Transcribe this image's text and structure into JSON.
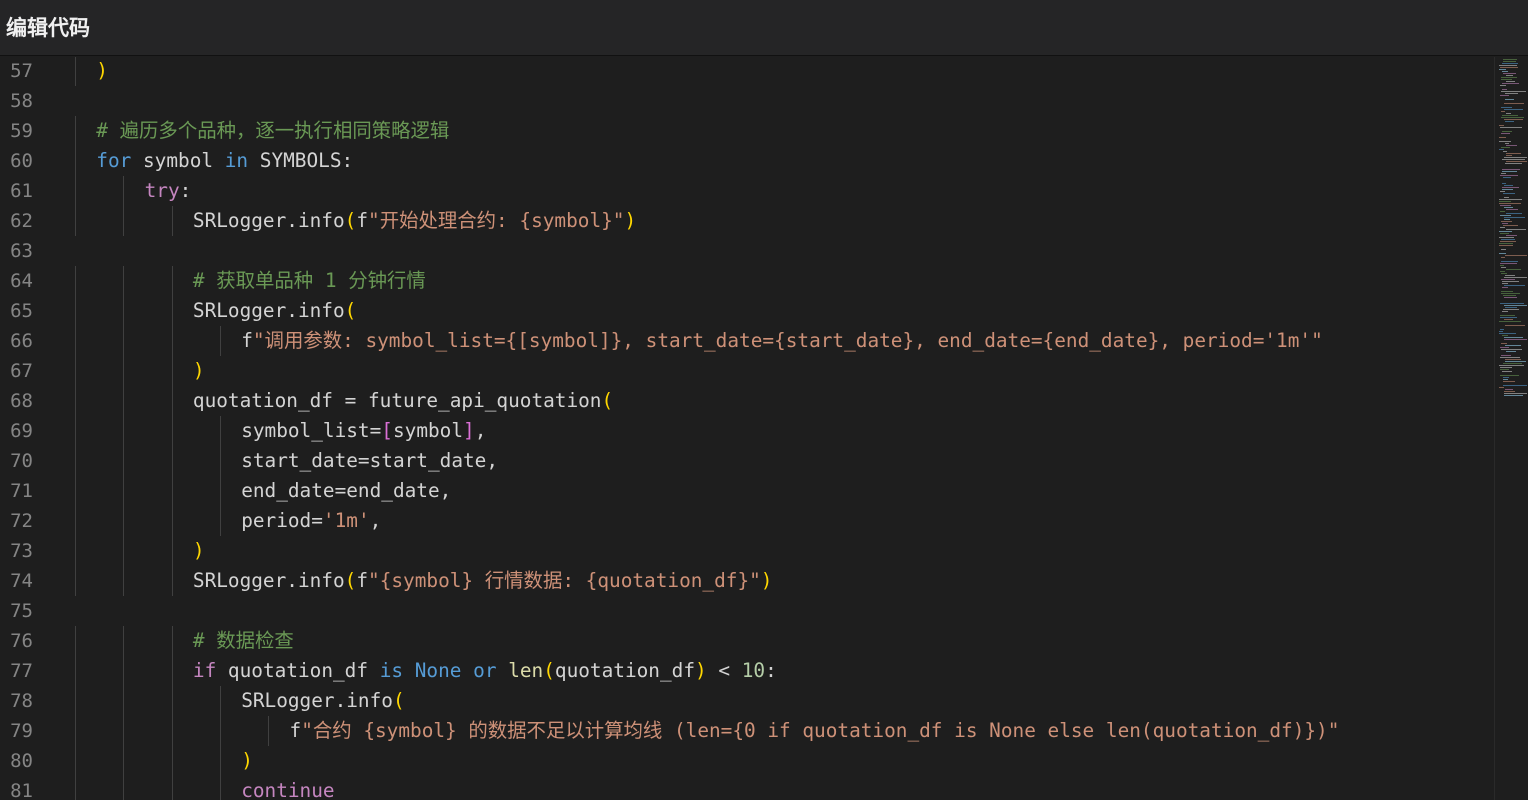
{
  "window": {
    "title": "编辑代码"
  },
  "editor": {
    "lines": [
      {
        "n": "57",
        "indent": 1,
        "tokens": [
          [
            "p1",
            ")"
          ]
        ]
      },
      {
        "n": "58",
        "indent": 0,
        "tokens": []
      },
      {
        "n": "59",
        "indent": 1,
        "tokens": [
          [
            "com",
            "# 遍历多个品种，逐一执行相同策略逻辑"
          ]
        ]
      },
      {
        "n": "60",
        "indent": 1,
        "tokens": [
          [
            "kw",
            "for"
          ],
          [
            "id",
            " symbol "
          ],
          [
            "kw",
            "in"
          ],
          [
            "id",
            " SYMBOLS:"
          ]
        ]
      },
      {
        "n": "61",
        "indent": 2,
        "tokens": [
          [
            "ctl",
            "try"
          ],
          [
            "id",
            ":"
          ]
        ]
      },
      {
        "n": "62",
        "indent": 3,
        "tokens": [
          [
            "id",
            "SRLogger.info"
          ],
          [
            "p1",
            "("
          ],
          [
            "id",
            "f"
          ],
          [
            "str",
            "\"开始处理合约: {symbol}\""
          ],
          [
            "p1",
            ")"
          ]
        ]
      },
      {
        "n": "63",
        "indent": 0,
        "tokens": []
      },
      {
        "n": "64",
        "indent": 3,
        "tokens": [
          [
            "com",
            "# 获取单品种 1 分钟行情"
          ]
        ]
      },
      {
        "n": "65",
        "indent": 3,
        "tokens": [
          [
            "id",
            "SRLogger.info"
          ],
          [
            "p1",
            "("
          ]
        ]
      },
      {
        "n": "66",
        "indent": 4,
        "tokens": [
          [
            "id",
            "f"
          ],
          [
            "str",
            "\"调用参数: symbol_list={[symbol]}, start_date={start_date}, end_date={end_date}, period='1m'\""
          ]
        ]
      },
      {
        "n": "67",
        "indent": 3,
        "tokens": [
          [
            "p1",
            ")"
          ]
        ]
      },
      {
        "n": "68",
        "indent": 3,
        "tokens": [
          [
            "id",
            "quotation_df = future_api_quotation"
          ],
          [
            "p1",
            "("
          ]
        ]
      },
      {
        "n": "69",
        "indent": 4,
        "tokens": [
          [
            "id",
            "symbol_list="
          ],
          [
            "p2",
            "["
          ],
          [
            "id",
            "symbol"
          ],
          [
            "p2",
            "]"
          ],
          [
            "id",
            ","
          ]
        ]
      },
      {
        "n": "70",
        "indent": 4,
        "tokens": [
          [
            "id",
            "start_date=start_date,"
          ]
        ]
      },
      {
        "n": "71",
        "indent": 4,
        "tokens": [
          [
            "id",
            "end_date=end_date,"
          ]
        ]
      },
      {
        "n": "72",
        "indent": 4,
        "tokens": [
          [
            "id",
            "period="
          ],
          [
            "str",
            "'1m'"
          ],
          [
            "id",
            ","
          ]
        ]
      },
      {
        "n": "73",
        "indent": 3,
        "tokens": [
          [
            "p1",
            ")"
          ]
        ]
      },
      {
        "n": "74",
        "indent": 3,
        "tokens": [
          [
            "id",
            "SRLogger.info"
          ],
          [
            "p1",
            "("
          ],
          [
            "id",
            "f"
          ],
          [
            "str",
            "\"{symbol} 行情数据: {quotation_df}\""
          ],
          [
            "p1",
            ")"
          ]
        ]
      },
      {
        "n": "75",
        "indent": 0,
        "tokens": []
      },
      {
        "n": "76",
        "indent": 3,
        "tokens": [
          [
            "com",
            "# 数据检查"
          ]
        ]
      },
      {
        "n": "77",
        "indent": 3,
        "tokens": [
          [
            "ctl",
            "if"
          ],
          [
            "id",
            " quotation_df "
          ],
          [
            "kw",
            "is"
          ],
          [
            "id",
            " "
          ],
          [
            "kw",
            "None"
          ],
          [
            "id",
            " "
          ],
          [
            "kw",
            "or"
          ],
          [
            "id",
            " "
          ],
          [
            "fn",
            "len"
          ],
          [
            "p1",
            "("
          ],
          [
            "id",
            "quotation_df"
          ],
          [
            "p1",
            ")"
          ],
          [
            "id",
            " < "
          ],
          [
            "num",
            "10"
          ],
          [
            "id",
            ":"
          ]
        ]
      },
      {
        "n": "78",
        "indent": 4,
        "tokens": [
          [
            "id",
            "SRLogger.info"
          ],
          [
            "p1",
            "("
          ]
        ]
      },
      {
        "n": "79",
        "indent": 5,
        "tokens": [
          [
            "id",
            "f"
          ],
          [
            "str",
            "\"合约 {symbol} 的数据不足以计算均线 (len={0 if quotation_df is None else len(quotation_df)})\""
          ]
        ]
      },
      {
        "n": "80",
        "indent": 4,
        "tokens": [
          [
            "p1",
            ")"
          ]
        ]
      },
      {
        "n": "81",
        "indent": 4,
        "tokens": [
          [
            "ctl",
            "continue"
          ]
        ]
      }
    ]
  }
}
